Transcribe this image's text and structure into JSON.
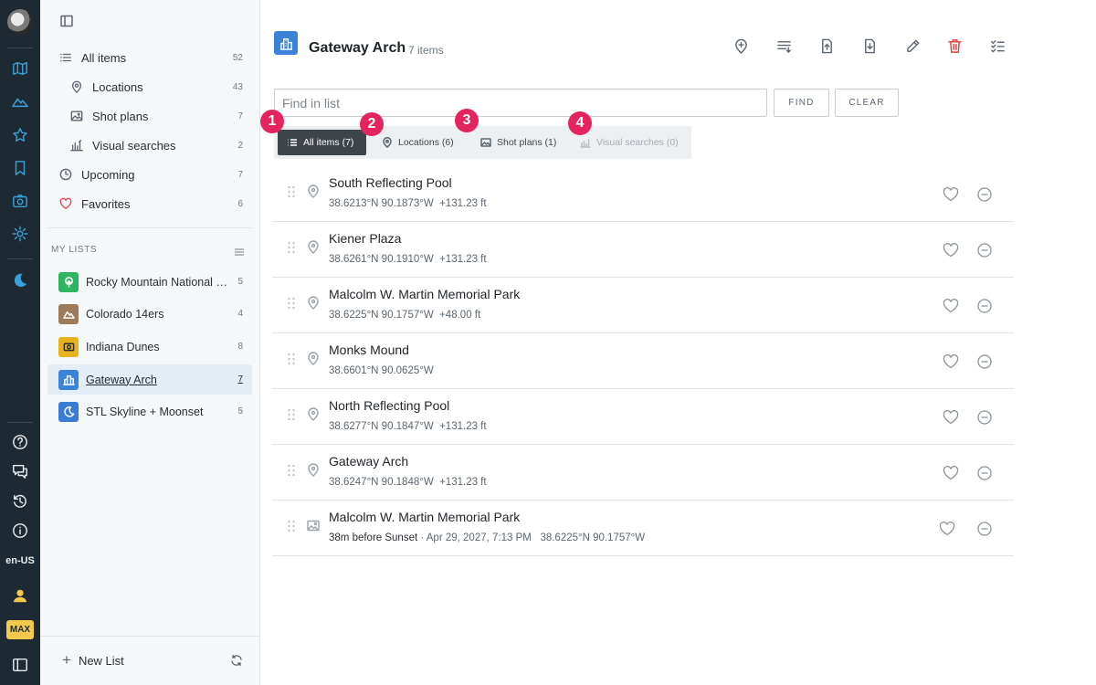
{
  "rail": {
    "language": "en-US",
    "plan_badge": "MAX",
    "icons": [
      "avatar",
      "map-icon",
      "mountain-icon",
      "star-icon",
      "bookmark-icon",
      "camera-icon",
      "gear-icon",
      "moon-icon",
      "help-icon",
      "chat-icon",
      "history-icon",
      "info-icon",
      "user-icon",
      "sidebar-toggle-icon"
    ]
  },
  "sidebar": {
    "nav": [
      {
        "label": "All items",
        "count": "52",
        "icon": "list-icon"
      },
      {
        "label": "Locations",
        "count": "43",
        "icon": "pin-icon"
      },
      {
        "label": "Shot plans",
        "count": "7",
        "icon": "image-icon"
      },
      {
        "label": "Visual searches",
        "count": "2",
        "icon": "visual-search-icon"
      },
      {
        "label": "Upcoming",
        "count": "7",
        "icon": "clock-icon"
      },
      {
        "label": "Favorites",
        "count": "6",
        "icon": "heart-icon"
      }
    ],
    "my_lists_label": "MY LISTS",
    "lists": [
      {
        "label": "Rocky Mountain National Park",
        "count": "5",
        "color": "#2fb562"
      },
      {
        "label": "Colorado 14ers",
        "count": "4",
        "color": "#9b7b5a"
      },
      {
        "label": "Indiana Dunes",
        "count": "8",
        "color": "#e8b21f"
      },
      {
        "label": "Gateway Arch",
        "count": "7",
        "color": "#3a83d8"
      },
      {
        "label": "STL Skyline + Moonset",
        "count": "5",
        "color": "#3a7bd5"
      }
    ],
    "new_list_label": "New List"
  },
  "header": {
    "title": "Gateway Arch",
    "count": "7 items"
  },
  "search": {
    "placeholder": "Find in list",
    "find_label": "FIND",
    "clear_label": "CLEAR"
  },
  "tabs": [
    {
      "label": "All items (7)",
      "badge": "1"
    },
    {
      "label": "Locations (6)",
      "badge": "2"
    },
    {
      "label": "Shot plans (1)",
      "badge": "3"
    },
    {
      "label": "Visual searches (0)",
      "badge": "4"
    }
  ],
  "items": [
    {
      "name": "South Reflecting Pool",
      "coords": "38.6213°N 90.1873°W",
      "elev": "+131.23 ft",
      "type": "location"
    },
    {
      "name": "Kiener Plaza",
      "coords": "38.6261°N 90.1910°W",
      "elev": "+131.23 ft",
      "type": "location"
    },
    {
      "name": "Malcolm W. Martin Memorial Park",
      "coords": "38.6225°N 90.1757°W",
      "elev": "+48.00 ft",
      "type": "location"
    },
    {
      "name": "Monks Mound",
      "coords": "38.6601°N 90.0625°W",
      "elev": "",
      "type": "location"
    },
    {
      "name": "North Reflecting Pool",
      "coords": "38.6277°N 90.1847°W",
      "elev": "+131.23 ft",
      "type": "location"
    },
    {
      "name": "Gateway Arch",
      "coords": "38.6247°N 90.1848°W",
      "elev": "+131.23 ft",
      "type": "location"
    },
    {
      "name": "Malcolm W. Martin Memorial Park",
      "event": "38m before Sunset",
      "date": " · Apr 29, 2027, 7:13 PM",
      "coords": "38.6225°N 90.1757°W",
      "elev": "",
      "type": "shot-plan"
    }
  ]
}
